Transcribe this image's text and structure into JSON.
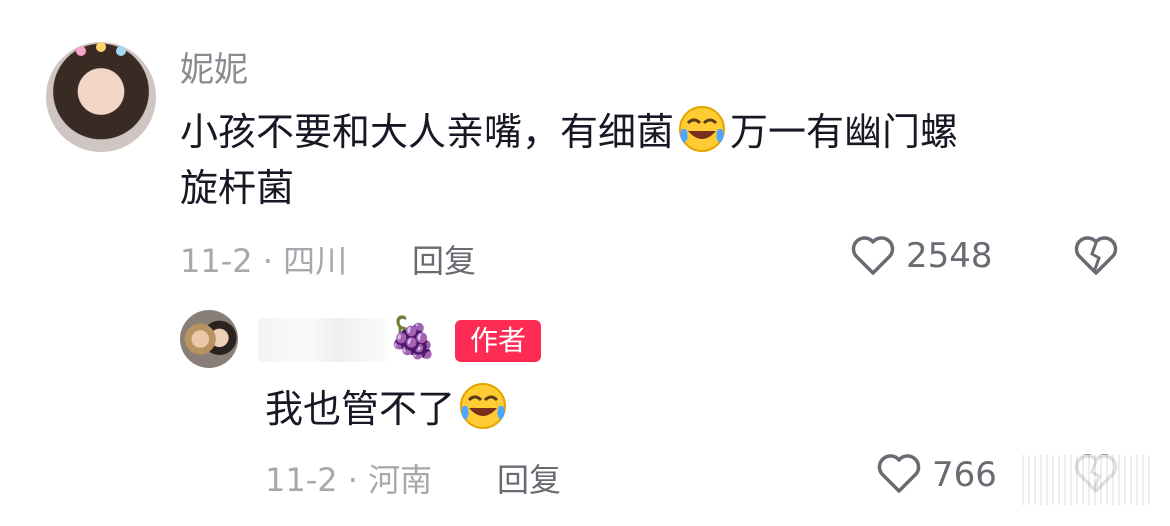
{
  "comment": {
    "username": "妮妮",
    "text_line1_a": "小孩不要和大人亲嘴，有细菌",
    "text_line1_b": "万一有幽门螺",
    "text_line2": "旋杆菌",
    "date_location": "11-2 · 四川",
    "reply_label": "回复",
    "like_count": "2548",
    "emoji": "rolling-on-floor-laughing-emoji"
  },
  "reply": {
    "grapes": "🍇",
    "author_badge": "作者",
    "text": "我也管不了",
    "date_location": "11-2 · 河南",
    "reply_label": "回复",
    "like_count": "766",
    "emoji": "rolling-on-floor-laughing-emoji"
  },
  "colors": {
    "text": "#161823",
    "meta": "#a7a8ad",
    "badge": "#fe2c55"
  }
}
